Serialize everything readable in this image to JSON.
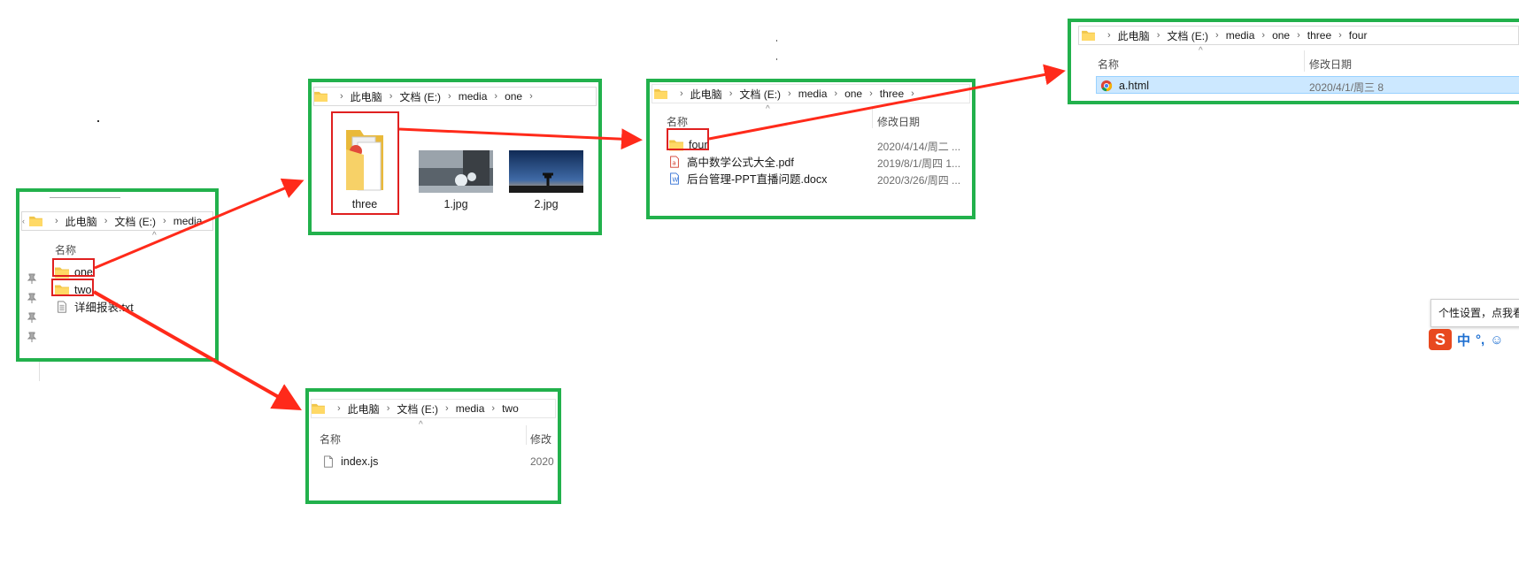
{
  "media_window": {
    "crumb": [
      "此电脑",
      "文档 (E:)",
      "media"
    ],
    "col_name": "名称",
    "items": [
      {
        "name": "one",
        "type": "folder"
      },
      {
        "name": "two",
        "type": "folder"
      },
      {
        "name": "详细报表.txt",
        "type": "txt"
      }
    ]
  },
  "one_window": {
    "crumb": [
      "此电脑",
      "文档 (E:)",
      "media",
      "one"
    ],
    "items": [
      {
        "name": "three",
        "type": "folder"
      },
      {
        "name": "1.jpg",
        "type": "image"
      },
      {
        "name": "2.jpg",
        "type": "image"
      }
    ]
  },
  "three_window": {
    "crumb": [
      "此电脑",
      "文档 (E:)",
      "media",
      "one",
      "three"
    ],
    "col_name": "名称",
    "col_date": "修改日期",
    "items": [
      {
        "name": "four",
        "type": "folder",
        "date": "2020/4/14/周二 ..."
      },
      {
        "name": "高中数学公式大全.pdf",
        "type": "pdf",
        "date": "2019/8/1/周四 1..."
      },
      {
        "name": "后台管理-PPT直播问题.docx",
        "type": "docx",
        "date": "2020/3/26/周四 ..."
      }
    ]
  },
  "four_window": {
    "crumb": [
      "此电脑",
      "文档 (E:)",
      "media",
      "one",
      "three",
      "four"
    ],
    "col_name": "名称",
    "col_date": "修改日期",
    "items": [
      {
        "name": "a.html",
        "type": "html",
        "date": "2020/4/1/周三 8"
      }
    ]
  },
  "two_window": {
    "crumb": [
      "此电脑",
      "文档 (E:)",
      "media",
      "two"
    ],
    "col_name": "名称",
    "col_date": "修改",
    "items": [
      {
        "name": "index.js",
        "type": "js",
        "date": "2020"
      }
    ]
  },
  "ime": {
    "tooltip": "个性设置，点我看",
    "logo": "S",
    "mode": "中",
    "punct": "°,",
    "emoji": "☺"
  },
  "colors": {
    "panel_border": "#22b14c",
    "highlight_border": "#e02020",
    "arrow": "#ff2a1a",
    "selection": "#cce8ff"
  }
}
